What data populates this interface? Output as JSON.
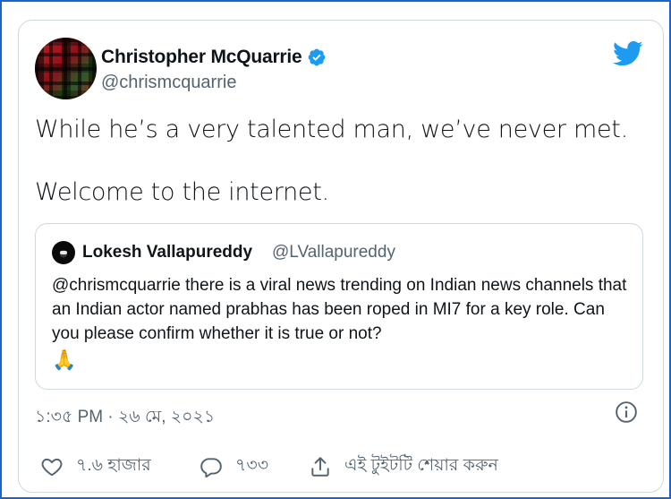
{
  "tweet": {
    "author_name": "Christopher McQuarrie",
    "author_handle": "@chrismcquarrie",
    "verified": true,
    "text_line1": "While he’s a very talented man, we’ve never met.",
    "text_line2": "Welcome to the internet.",
    "timestamp": "১:৩৫ PM · ২৬ মে, ২০২১"
  },
  "quote": {
    "author_name": "Lokesh Vallapureddy",
    "author_handle": "@LVallapureddy",
    "text": "@chrismcquarrie there is a viral news trending on Indian news channels that an Indian actor named prabhas has been roped in MI7 for a key role. Can you please confirm whether it is true or not?",
    "emoji": "🙏"
  },
  "actions": {
    "likes": "৭.৬ হাজার",
    "replies": "৭৩৩",
    "share_label": "এই টুইটটি শেয়ার করুন"
  },
  "icons": {
    "brand": "twitter-bird-icon",
    "verified": "verified-badge-icon",
    "info": "info-icon",
    "like": "heart-icon",
    "reply": "reply-bubble-icon",
    "share": "share-upload-icon"
  },
  "colors": {
    "brand_blue": "#1d9bf0",
    "frame_blue": "#1d64c8",
    "text": "#0f1419",
    "secondary": "#536471",
    "border": "#cfd9de"
  }
}
